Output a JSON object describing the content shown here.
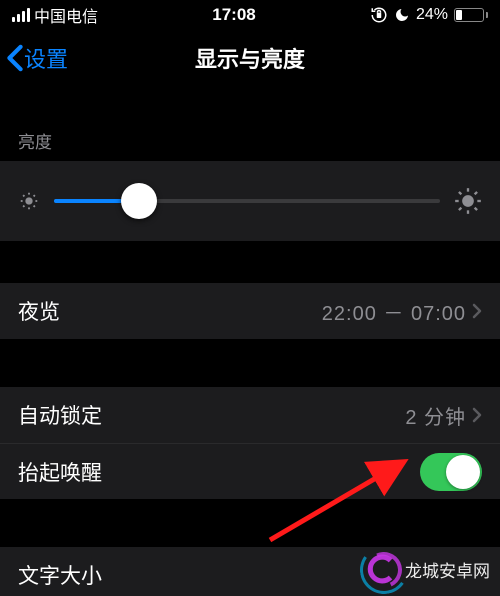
{
  "status": {
    "carrier": "中国电信",
    "time": "17:08",
    "battery_pct": "24%",
    "battery_level": 24
  },
  "nav": {
    "back_label": "设置",
    "title": "显示与亮度"
  },
  "brightness": {
    "header": "亮度",
    "value_pct": 22
  },
  "night_shift": {
    "label": "夜览",
    "value": "22:00 － 07:00"
  },
  "auto_lock": {
    "label": "自动锁定",
    "value": "2 分钟"
  },
  "raise_to_wake": {
    "label": "抬起唤醒",
    "on": true
  },
  "text_size": {
    "label": "文字大小"
  },
  "watermark": {
    "site": "龙城安卓网"
  },
  "colors": {
    "accent": "#0a84ff",
    "toggle_on": "#34c759",
    "cell_bg": "#1c1c1e",
    "secondary_text": "#8e8e93"
  }
}
